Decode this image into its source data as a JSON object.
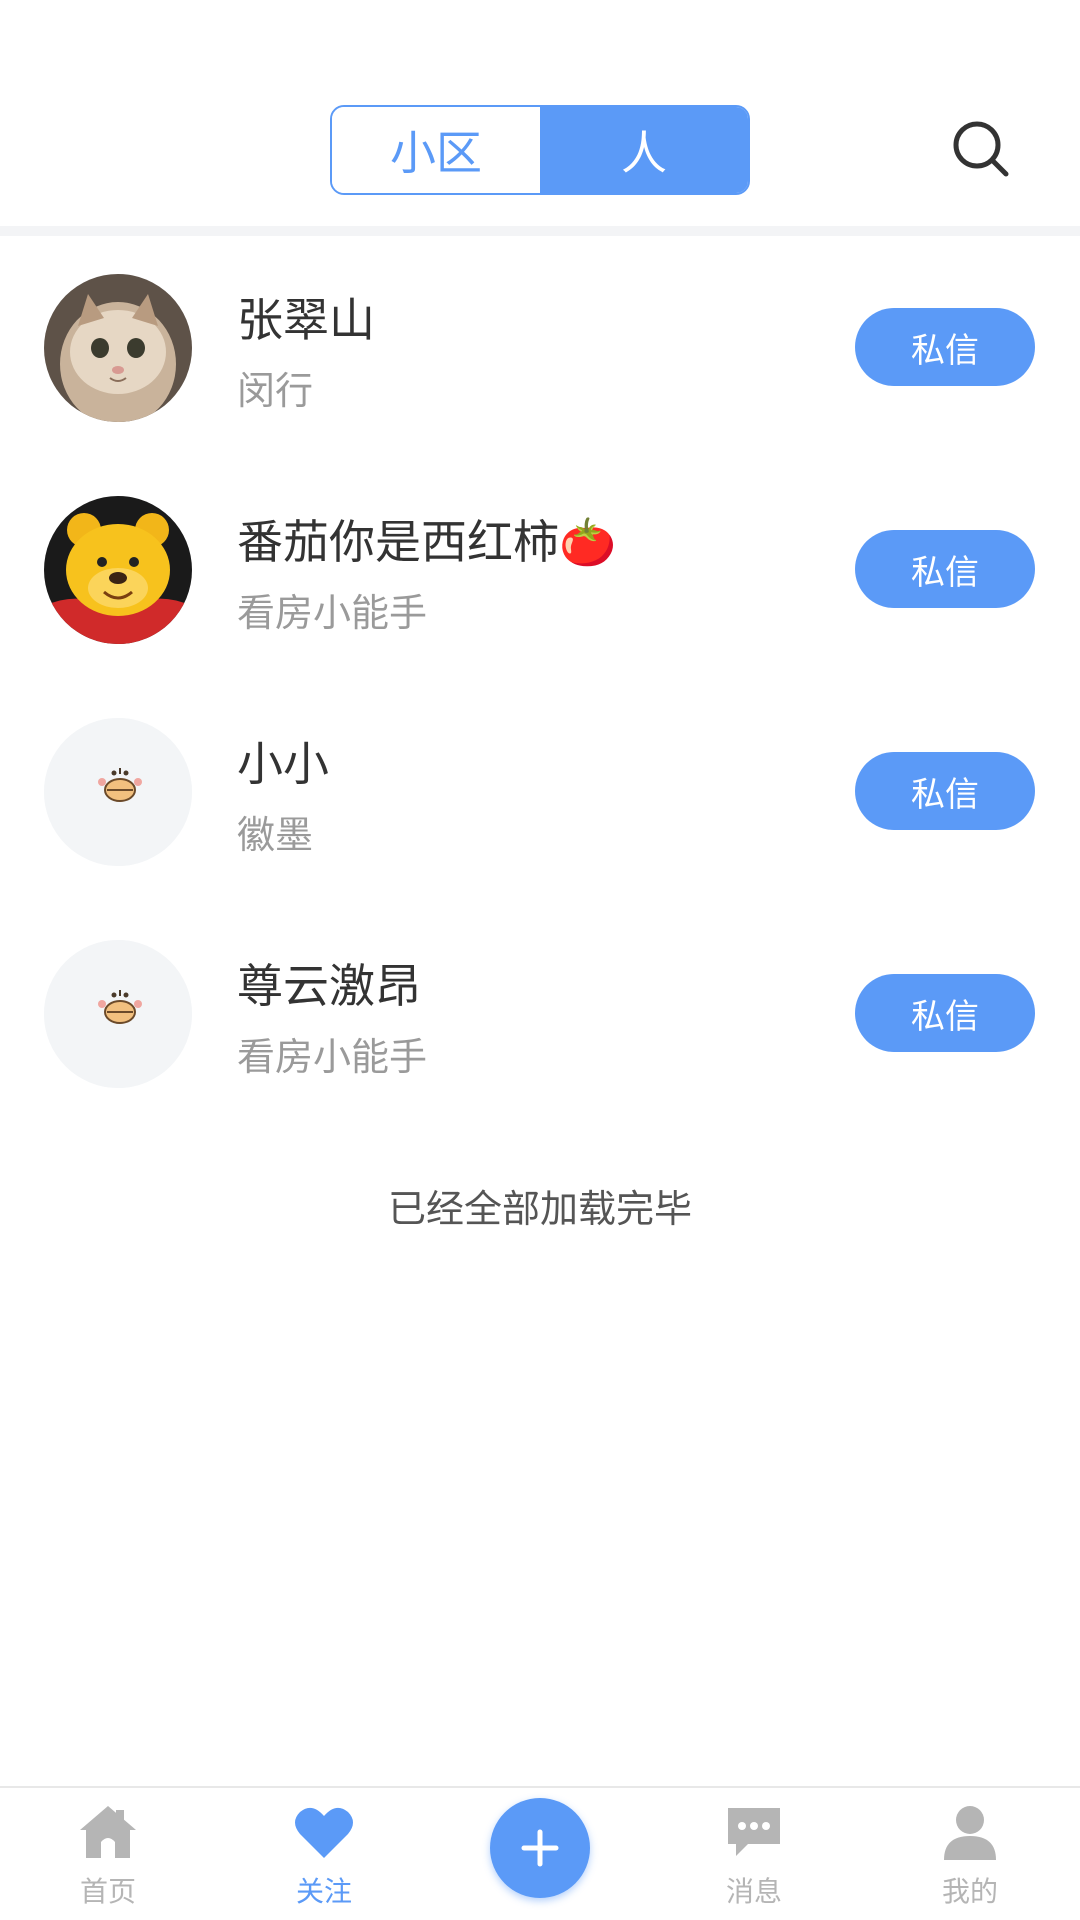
{
  "header": {
    "tabs": [
      {
        "label": "小区",
        "active": false
      },
      {
        "label": "人",
        "active": true
      }
    ],
    "search_icon": "search-icon"
  },
  "follow_list": [
    {
      "name": "张翠山",
      "subtitle": "闵行",
      "action": "私信",
      "avatar": "cat-photo-avatar"
    },
    {
      "name": "番茄你是西红柿🍅",
      "subtitle": "看房小能手",
      "action": "私信",
      "avatar": "winnie-the-pooh-avatar"
    },
    {
      "name": "小小",
      "subtitle": "徽墨",
      "action": "私信",
      "avatar": "default-cartoon-avatar"
    },
    {
      "name": "尊云激昂",
      "subtitle": "看房小能手",
      "action": "私信",
      "avatar": "default-cartoon-avatar"
    }
  ],
  "list_end_note": "已经全部加载完毕",
  "bottom_nav": {
    "items": [
      {
        "label": "首页",
        "icon": "home-icon",
        "active": false
      },
      {
        "label": "关注",
        "icon": "heart-icon",
        "active": true
      },
      {
        "label": "",
        "icon": "plus-icon",
        "active": false
      },
      {
        "label": "消息",
        "icon": "chat-bubble-icon",
        "active": false
      },
      {
        "label": "我的",
        "icon": "user-icon",
        "active": false
      }
    ]
  },
  "colors": {
    "accent": "#5b9af7",
    "text_primary": "#333333",
    "text_secondary": "#9a9a9a",
    "nav_inactive": "#b5b5b5",
    "divider": "#f3f4f6"
  }
}
